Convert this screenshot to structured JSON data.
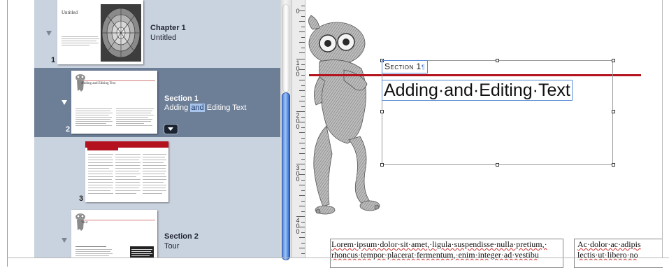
{
  "sidebar": {
    "pages": [
      {
        "number": "1",
        "title": "Chapter 1",
        "subtitle": "Untitled",
        "thumb_title": "Untitled"
      },
      {
        "number": "2",
        "title": "Section 1",
        "subtitle_before": "Adding ",
        "subtitle_highlight": "and",
        "subtitle_after": " Editing Text",
        "thumb_title": "Adding and Editing Text"
      },
      {
        "number": "3"
      },
      {
        "number": "",
        "title": "Section 2",
        "subtitle": "Tour",
        "thumb_title": "Tour"
      }
    ]
  },
  "ruler": {
    "labels": [
      {
        "digits": [
          "0"
        ]
      },
      {
        "digits": [
          "1",
          "0",
          "0"
        ]
      },
      {
        "digits": [
          "2",
          "0",
          "0"
        ]
      },
      {
        "digits": [
          "3",
          "0",
          "0"
        ]
      },
      {
        "digits": [
          "4",
          "0",
          "0"
        ]
      }
    ]
  },
  "canvas": {
    "section_label": "Section 1",
    "pilcrow": "¶",
    "heading": "Adding·and·Editing·Text",
    "body_col1_line1": "Lorem·ipsum·dolor·sit·amet,·ligula·suspendisse·nulla·pretium,·",
    "body_col1_line2": "rhoncus·tempor·placerat·fermentum,·enim·integer·ad·vestibu",
    "body_col2_line1": "Ac·dolor·ac·adipis",
    "body_col2_line2": "lectis·ut·libero·no"
  },
  "colors": {
    "sidebar_bg": "#c9d2df",
    "selected_row": "#6d7e97",
    "accent_red": "#b3121e",
    "selection_blue": "#5a8ad6"
  }
}
